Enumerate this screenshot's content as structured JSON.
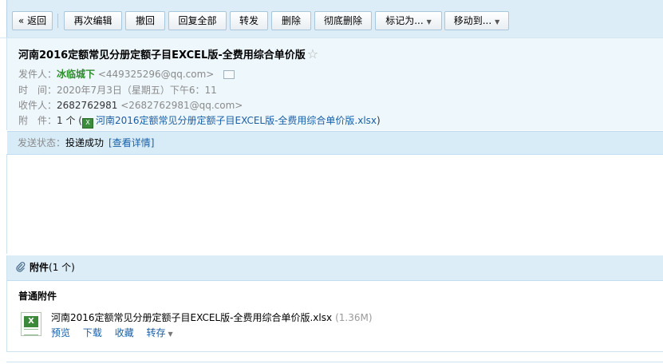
{
  "toolbar": {
    "back": "« 返回",
    "reedit": "再次编辑",
    "withdraw": "撤回",
    "reply_all": "回复全部",
    "forward": "转发",
    "delete": "删除",
    "perm_delete": "彻底删除",
    "mark_as": "标记为...",
    "move_to": "移动到..."
  },
  "email": {
    "subject": "河南2016定额常见分册定额子目EXCEL版-全费用综合单价版",
    "star": "☆",
    "from_label": "发件人：",
    "from_name": "冰临城下",
    "from_addr": "<449325296@qq.com>",
    "time_label": "时　间：",
    "time_value": "2020年7月3日（星期五）下午6：11",
    "to_label": "收件人：",
    "to_name": "2682762981",
    "to_addr": "<2682762981@qq.com>",
    "attach_label": "附　件：",
    "attach_count": "1 个 (",
    "attach_file": "河南2016定额常见分册定额子目EXCEL版-全费用综合单价版.xlsx",
    "attach_close": ")",
    "status_label": "发送状态：",
    "status_value": "投递成功",
    "status_link": "[查看详情]"
  },
  "attachments": {
    "title": "附件",
    "count": "(1 个)",
    "type_label": "普通附件",
    "file_name": "河南2016定额常见分册定额子目EXCEL版-全费用综合单价版.xlsx",
    "file_size": "(1.36M)",
    "preview": "预览",
    "download": "下载",
    "collect": "收藏",
    "save_to": "转存"
  }
}
